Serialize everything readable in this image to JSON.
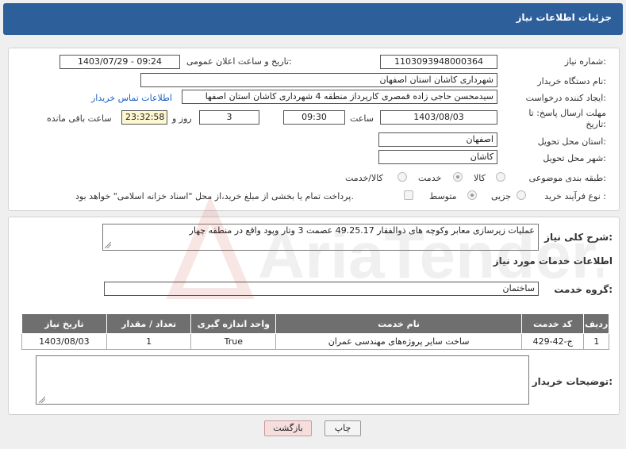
{
  "page": {
    "title": "جزئیات اطلاعات نیاز"
  },
  "form": {
    "need_number_label": "شماره نیاز:",
    "need_number": "1103093948000364",
    "announce_label": "تاریخ و ساعت اعلان عمومی:",
    "announce_value": "1403/07/29 - 09:24",
    "buyer_org_label": "نام دستگاه خریدار:",
    "buyer_org": "شهرداری کاشان استان اصفهان",
    "creator_label": "ایجاد کننده درخواست:",
    "creator": "سیدمحسن حاجی زاده قمصری کارپرداز منطقه 4 شهرداری کاشان استان اصفها",
    "contact_link": "اطلاعات تماس خریدار",
    "deadline_label_1": "مهلت ارسال پاسخ: تا",
    "deadline_label_2": "تاریخ:",
    "deadline_date": "1403/08/03",
    "time_label": "ساعت",
    "deadline_time": "09:30",
    "days_value": "3",
    "days_label": "روز و",
    "remaining_time": "23:32:58",
    "remaining_label": "ساعت باقی مانده",
    "province_label": "استان محل تحویل:",
    "province": "اصفهان",
    "city_label": "شهر محل تحویل:",
    "city": "کاشان",
    "category_label": "طبقه بندی موضوعی:",
    "category_options": [
      "کالا",
      "خدمت",
      "کالا/خدمت"
    ],
    "category_selected": "خدمت",
    "process_label": "نوع فرآیند خرید :",
    "process_options": [
      "جزیی",
      "متوسط"
    ],
    "process_selected": "متوسط",
    "treasury_note": "پرداخت تمام یا بخشی از مبلغ خرید،از محل \"اسناد خزانه اسلامی\" خواهد بود."
  },
  "details": {
    "summary_label": "شرح کلی نیاز:",
    "summary": "عملیات زیرسازی معابر وکوچه های ذوالفقار 49.25.17 عصمت 3 وتار وپود واقع در منطقه چهار",
    "services_title": "اطلاعات خدمات مورد نیاز",
    "service_group_label": "گروه خدمت:",
    "service_group": "ساختمان",
    "table": {
      "headers": [
        "ردیف",
        "کد خدمت",
        "نام خدمت",
        "واحد اندازه گیری",
        "تعداد / مقدار",
        "تاریخ نیاز"
      ],
      "rows": [
        [
          "1",
          "ج-42-429",
          "ساخت سایر پروژه‌های مهندسی عمران",
          "True",
          "1",
          "1403/08/03"
        ]
      ]
    },
    "buyer_notes_label": "توضیحات خریدار:",
    "buyer_notes": ""
  },
  "buttons": {
    "print": "چاپ",
    "back": "بازگشت"
  },
  "watermark": {
    "text": "AriaTender.net"
  },
  "colors": {
    "header": "#2d5f9a",
    "table_header": "#6f6f6f",
    "back_button": "#f7dede",
    "link": "#1a5fc0"
  }
}
